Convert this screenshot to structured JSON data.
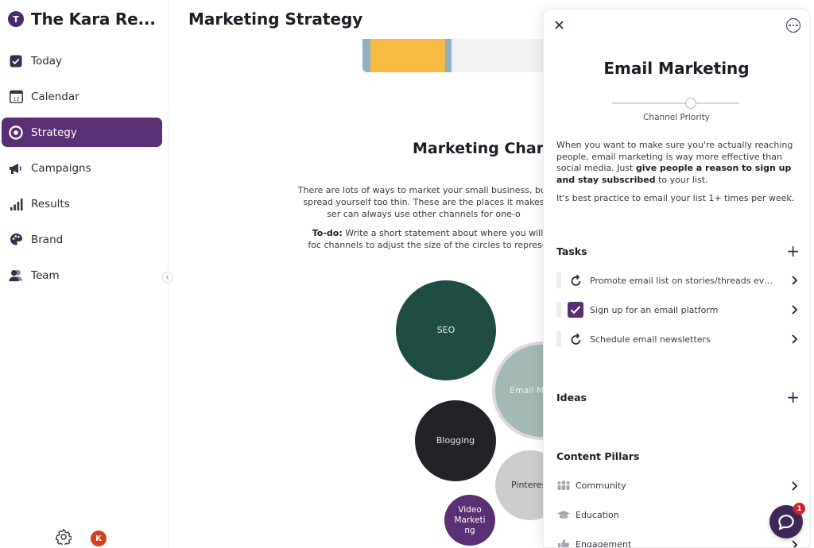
{
  "workspace": {
    "initial": "T",
    "name": "The Kara Re..."
  },
  "nav": [
    {
      "label": "Today",
      "icon": "check-square-icon"
    },
    {
      "label": "Calendar",
      "icon": "calendar-icon",
      "icon_text": "12"
    },
    {
      "label": "Strategy",
      "icon": "target-icon",
      "active": true
    },
    {
      "label": "Campaigns",
      "icon": "megaphone-icon"
    },
    {
      "label": "Results",
      "icon": "bar-chart-icon"
    },
    {
      "label": "Brand",
      "icon": "palette-icon"
    },
    {
      "label": "Team",
      "icon": "team-icon"
    }
  ],
  "footer": {
    "user_initial": "K"
  },
  "main": {
    "title": "Marketing Strategy",
    "section_title": "Marketing Chan",
    "intro": "There are lots of ways to market your small business, but spread yourself too thin. These are the places it makes ser can always use other channels for one-o",
    "todo_label": "To-do:",
    "todo_text": "Write a short statement about where you will foc channels to adjust the size of the circles to represe"
  },
  "bubbles": [
    {
      "label": "SEO",
      "color": "#1d4d43"
    },
    {
      "label": "Email Ma",
      "color": "#a3b9b3"
    },
    {
      "label": "Blogging",
      "color": "#222326"
    },
    {
      "label": "Pinteres",
      "color": "#cdcdcd"
    },
    {
      "label": "Video Marketi ng",
      "color": "#5a2f73"
    }
  ],
  "panel": {
    "title": "Email Marketing",
    "priority_label": "Channel Priority",
    "priority_value": 0.62,
    "desc_lead": "When you want to make sure you're actually reaching people, email marketing is way more effective than social media. Just ",
    "desc_bold": "give people a reason to sign up and stay subscribed",
    "desc_tail": " to your list.",
    "desc2": "It's best practice to email your list 1+ times per week.",
    "tasks_heading": "Tasks",
    "tasks": [
      {
        "label": "Promote email list on stories/threads every ...",
        "done": false
      },
      {
        "label": "Sign up for an email platform",
        "done": true
      },
      {
        "label": "Schedule email newsletters",
        "done": false
      }
    ],
    "ideas_heading": "Ideas",
    "pillars_heading": "Content Pillars",
    "pillars": [
      {
        "label": "Community",
        "icon": "community-icon"
      },
      {
        "label": "Education",
        "icon": "graduation-cap-icon"
      },
      {
        "label": "Engagement",
        "icon": "thumbs-up-icon"
      }
    ]
  },
  "chat": {
    "badge": "1"
  },
  "colors": {
    "accent": "#5a2f73",
    "dark_accent": "#3b2456"
  }
}
